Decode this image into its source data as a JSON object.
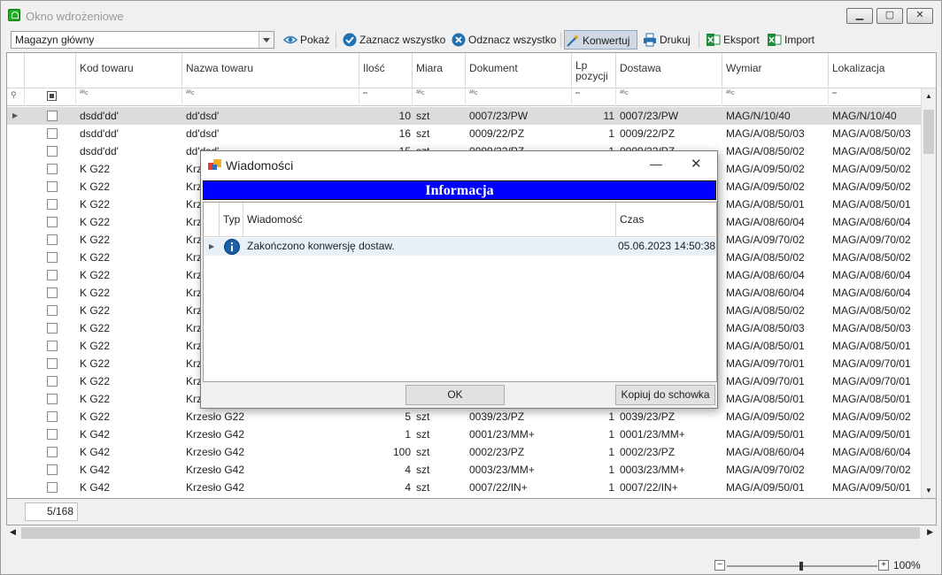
{
  "window": {
    "title": "Okno wdrożeniowe",
    "min": "▁",
    "max": "▢",
    "close": "✕"
  },
  "toolbar": {
    "warehouse": "Magazyn główny",
    "show": "Pokaż",
    "select_all": "Zaznacz wszystko",
    "deselect_all": "Odznacz wszystko",
    "convert": "Konwertuj",
    "print": "Drukuj",
    "export": "Eksport",
    "import": "Import"
  },
  "grid": {
    "columns": [
      "Kod towaru",
      "Nazwa towaru",
      "Ilość",
      "Miara",
      "Dokument",
      "Lp pozycji",
      "Dostawa",
      "Wymiar",
      "Lokalizacja"
    ],
    "filters": {
      "text": "ᴬᴮc",
      "num": "═"
    },
    "rows": [
      [
        "dsdd'dd'",
        "dd'dsd'",
        "10",
        "szt",
        "0007/23/PW",
        "11",
        "0007/23/PW",
        "MAG/N/10/40",
        "MAG/N/10/40"
      ],
      [
        "dsdd'dd'",
        "dd'dsd'",
        "16",
        "szt",
        "0009/22/PZ",
        "1",
        "0009/22/PZ",
        "MAG/A/08/50/03",
        "MAG/A/08/50/03"
      ],
      [
        "dsdd'dd'",
        "dd'dsd'",
        "15",
        "szt",
        "0009/22/PZ",
        "1",
        "0009/22/PZ",
        "MAG/A/08/50/02",
        "MAG/A/08/50/02"
      ],
      [
        "K G22",
        "Krzesło G22",
        "",
        "",
        "",
        "",
        "",
        "MAG/A/09/50/02",
        "MAG/A/09/50/02"
      ],
      [
        "K G22",
        "Krzesło G22",
        "",
        "",
        "",
        "",
        "",
        "MAG/A/09/50/02",
        "MAG/A/09/50/02"
      ],
      [
        "K G22",
        "Krzesło G22",
        "",
        "",
        "",
        "",
        "",
        "MAG/A/08/50/01",
        "MAG/A/08/50/01"
      ],
      [
        "K G22",
        "Krzesło G22",
        "",
        "",
        "",
        "",
        "",
        "MAG/A/08/60/04",
        "MAG/A/08/60/04"
      ],
      [
        "K G22",
        "Krzesło G22",
        "",
        "",
        "",
        "",
        "",
        "MAG/A/09/70/02",
        "MAG/A/09/70/02"
      ],
      [
        "K G22",
        "Krzesło G22",
        "",
        "",
        "",
        "",
        "",
        "MAG/A/08/50/02",
        "MAG/A/08/50/02"
      ],
      [
        "K G22",
        "Krzesło G22",
        "",
        "",
        "",
        "",
        "",
        "MAG/A/08/60/04",
        "MAG/A/08/60/04"
      ],
      [
        "K G22",
        "Krzesło G22",
        "",
        "",
        "",
        "",
        "",
        "MAG/A/08/60/04",
        "MAG/A/08/60/04"
      ],
      [
        "K G22",
        "Krzesło G22",
        "",
        "",
        "",
        "",
        "",
        "MAG/A/08/50/02",
        "MAG/A/08/50/02"
      ],
      [
        "K G22",
        "Krzesło G22",
        "",
        "",
        "",
        "",
        "",
        "MAG/A/08/50/03",
        "MAG/A/08/50/03"
      ],
      [
        "K G22",
        "Krzesło G22",
        "",
        "",
        "",
        "",
        "",
        "MAG/A/08/50/01",
        "MAG/A/08/50/01"
      ],
      [
        "K G22",
        "Krzesło G22",
        "",
        "",
        "",
        "",
        "",
        "MAG/A/09/70/01",
        "MAG/A/09/70/01"
      ],
      [
        "K G22",
        "Krzesło G22",
        "",
        "",
        "",
        "",
        "",
        "MAG/A/09/70/01",
        "MAG/A/09/70/01"
      ],
      [
        "K G22",
        "Krzesło G22",
        "",
        "",
        "",
        "",
        "",
        "MAG/A/08/50/01",
        "MAG/A/08/50/01"
      ],
      [
        "K G22",
        "Krzesło G22",
        "5",
        "szt",
        "0039/23/PZ",
        "1",
        "0039/23/PZ",
        "MAG/A/09/50/02",
        "MAG/A/09/50/02"
      ],
      [
        "K G42",
        "Krzesło G42",
        "1",
        "szt",
        "0001/23/MM+",
        "1",
        "0001/23/MM+",
        "MAG/A/09/50/01",
        "MAG/A/09/50/01"
      ],
      [
        "K G42",
        "Krzesło G42",
        "100",
        "szt",
        "0002/23/PZ",
        "1",
        "0002/23/PZ",
        "MAG/A/08/60/04",
        "MAG/A/08/60/04"
      ],
      [
        "K G42",
        "Krzesło G42",
        "4",
        "szt",
        "0003/23/MM+",
        "1",
        "0003/23/MM+",
        "MAG/A/09/70/02",
        "MAG/A/09/70/02"
      ],
      [
        "K G42",
        "Krzesło G42",
        "4",
        "szt",
        "0007/22/IN+",
        "1",
        "0007/22/IN+",
        "MAG/A/09/50/01",
        "MAG/A/09/50/01"
      ]
    ],
    "record_counter": "5/168"
  },
  "status": {
    "zoom": "100%"
  },
  "dialog": {
    "title": "Wiadomości",
    "banner": "Informacja",
    "columns": [
      "Typ",
      "Wiadomość",
      "Czas"
    ],
    "message": "Zakończono konwersję dostaw.",
    "time": "05.06.2023 14:50:38",
    "ok": "OK",
    "copy": "Kopiuj do schowka"
  }
}
